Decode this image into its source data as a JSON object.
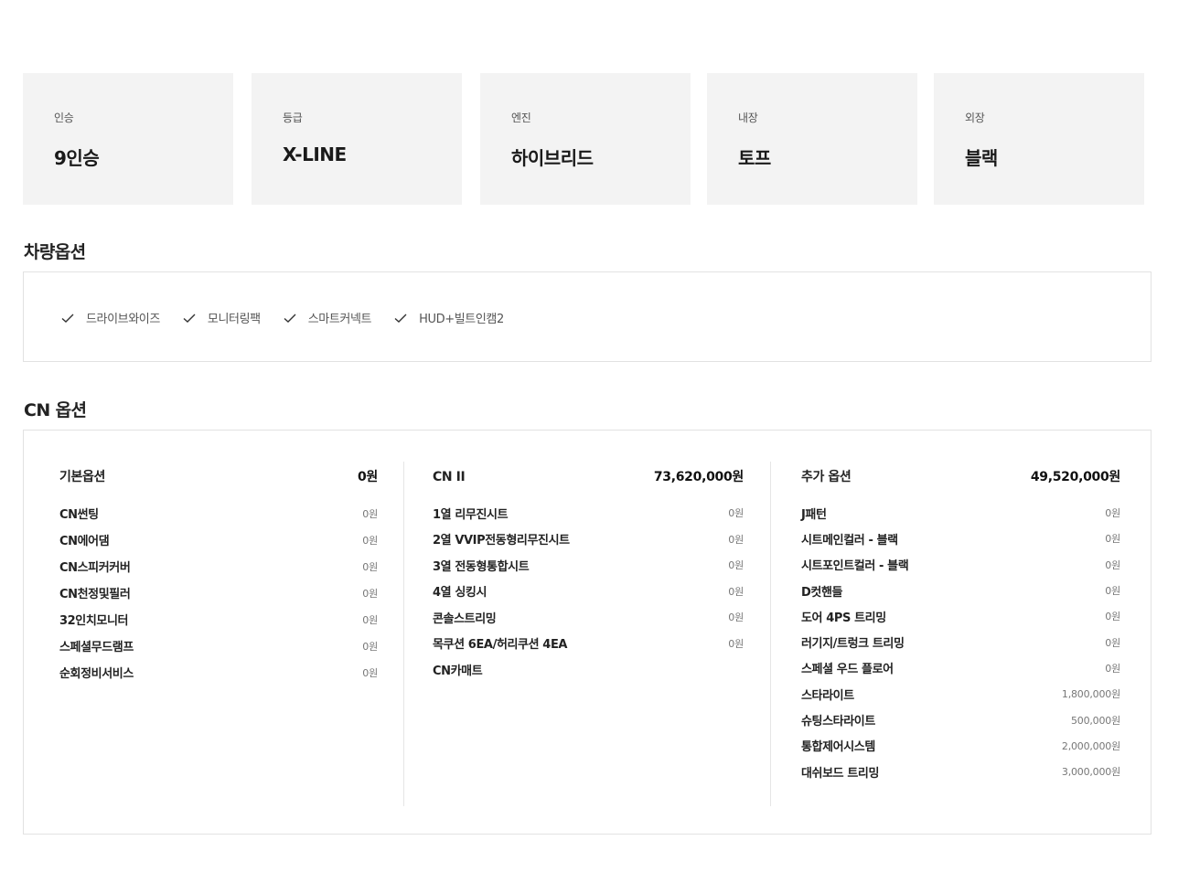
{
  "specs": [
    {
      "label": "인승",
      "value": "9인승"
    },
    {
      "label": "등급",
      "value": "X-LINE"
    },
    {
      "label": "엔진",
      "value": "하이브리드"
    },
    {
      "label": "내장",
      "value": "토프"
    },
    {
      "label": "외장",
      "value": "블랙"
    }
  ],
  "vehicle_options": {
    "title": "차량옵션",
    "items": [
      "드라이브와이즈",
      "모니터링팩",
      "스마트커넥트",
      "HUD+빌트인캠2"
    ]
  },
  "cn_options": {
    "title": "CN 옵션",
    "columns": [
      {
        "title": "기본옵션",
        "total": "0원",
        "items": [
          {
            "name": "CN썬팅",
            "price": "0원"
          },
          {
            "name": "CN에어댐",
            "price": "0원"
          },
          {
            "name": "CN스피커커버",
            "price": "0원"
          },
          {
            "name": "CN천정및필러",
            "price": "0원"
          },
          {
            "name": "32인치모니터",
            "price": "0원"
          },
          {
            "name": "스페셜무드램프",
            "price": "0원"
          },
          {
            "name": "순회정비서비스",
            "price": "0원"
          }
        ]
      },
      {
        "title": "CN II",
        "total": "73,620,000원",
        "items": [
          {
            "name": "1열 리무진시트",
            "price": "0원"
          },
          {
            "name": "2열 VVIP전동형리무진시트",
            "price": "0원"
          },
          {
            "name": "3열 전동형통합시트",
            "price": "0원"
          },
          {
            "name": "4열 싱킹시",
            "price": "0원"
          },
          {
            "name": "콘솔스트리밍",
            "price": "0원"
          },
          {
            "name": "목쿠션 6EA/허리쿠션 4EA",
            "price": "0원"
          },
          {
            "name": "CN카매트",
            "price": ""
          }
        ]
      },
      {
        "title": "추가 옵션",
        "total": "49,520,000원",
        "items": [
          {
            "name": "J패턴",
            "price": "0원"
          },
          {
            "name": "시트메인컬러 - 블랙",
            "price": "0원"
          },
          {
            "name": "시트포인트컬러 - 블랙",
            "price": "0원"
          },
          {
            "name": "D컷핸들",
            "price": "0원"
          },
          {
            "name": "도어 4PS 트리밍",
            "price": "0원"
          },
          {
            "name": "러기지/트렁크 트리밍",
            "price": "0원"
          },
          {
            "name": "스페셜 우드 플로어",
            "price": "0원"
          },
          {
            "name": "스타라이트",
            "price": "1,800,000원"
          },
          {
            "name": "슈팅스타라이트",
            "price": "500,000원"
          },
          {
            "name": "통합제어시스템",
            "price": "2,000,000원"
          },
          {
            "name": "대쉬보드 트리밍",
            "price": "3,000,000원"
          }
        ]
      }
    ]
  }
}
